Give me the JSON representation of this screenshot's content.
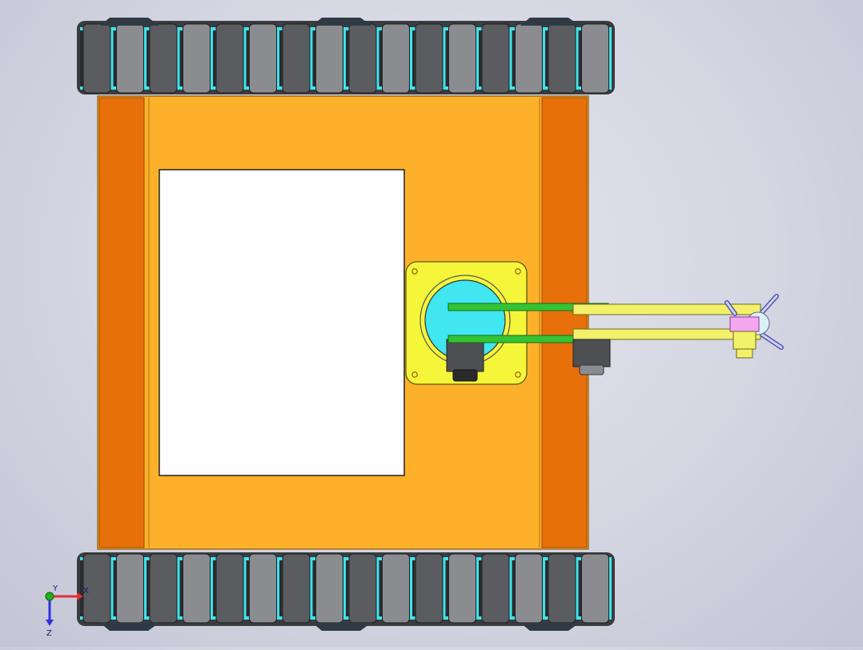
{
  "viewport": {
    "background_top": "#e4e5ed",
    "background_bottom": "#c3c5d6"
  },
  "model": {
    "chassis": {
      "body_color": "#fdb12a",
      "side_rail_color": "#e8700a",
      "lid_color": "#ffffff"
    },
    "tracks": {
      "count": 2,
      "pads_per_track": 16,
      "pad_color_dark": "#5a5c60",
      "pad_color_light": "#8a8c90",
      "link_color": "#3fe4ec"
    },
    "mount_plate": {
      "color": "#f5f53a",
      "bearing_color": "#40e6f0"
    },
    "arm": {
      "link_color": "#f3f06a",
      "belt_color": "#34c334",
      "gripper_color": "#f5a6f0"
    },
    "icons": [
      "axis-triad-icon"
    ]
  },
  "axis_triad": {
    "x_label": "X",
    "y_label": "Y",
    "z_label": "Z",
    "x_color": "#e03030",
    "y_color": "#20b020",
    "z_color": "#3030e0"
  }
}
